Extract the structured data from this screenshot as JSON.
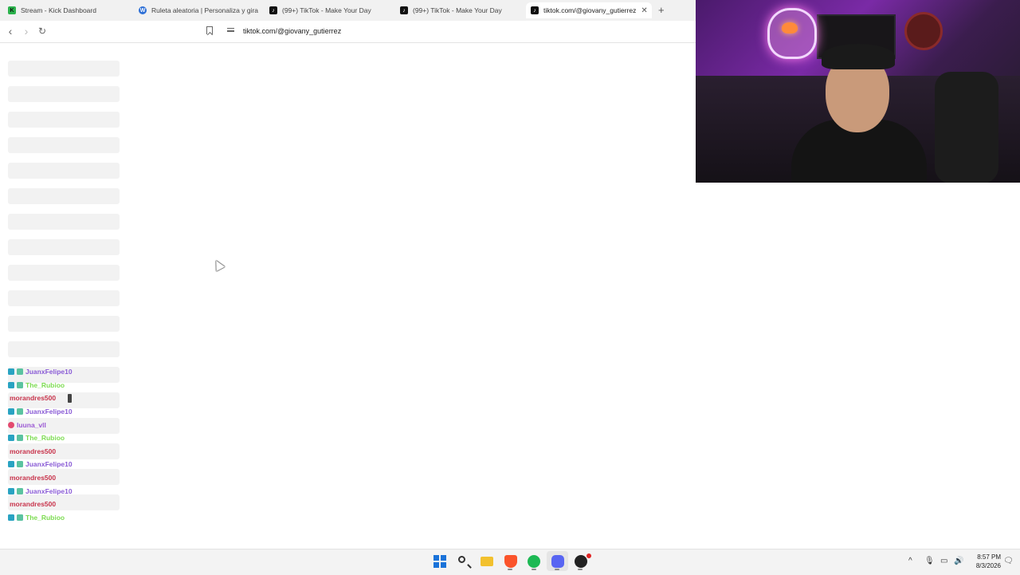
{
  "browser": {
    "tabs": [
      {
        "label": "Stream - Kick Dashboard",
        "favicon": "kick-icon"
      },
      {
        "label": "Ruleta aleatoria | Personaliza y gira t",
        "favicon": "wheel-icon"
      },
      {
        "label": "(99+) TikTok - Make Your Day",
        "favicon": "tiktok-icon"
      },
      {
        "label": "(99+) TikTok - Make Your Day",
        "favicon": "tiktok-icon"
      },
      {
        "label": "tiktok.com/@giovany_gutierrez",
        "favicon": "tiktok-icon",
        "active": true
      }
    ],
    "close_glyph": "✕",
    "new_tab_glyph": "+",
    "nav": {
      "back": "‹",
      "forward": "›",
      "reload": "↻"
    },
    "url": "tiktok.com/@giovany_gutierrez"
  },
  "chat": {
    "messages": [
      {
        "user": "JuanxFelipe10",
        "color": "#8a5cd6",
        "badges": [
          "sub",
          "gift"
        ]
      },
      {
        "user": "The_Rubioo",
        "color": "#7ddc52",
        "badges": [
          "sub",
          "gift"
        ]
      },
      {
        "user": "morandres500",
        "color": "#c8344c",
        "badges": [],
        "emote": true
      },
      {
        "user": "JuanxFelipe10",
        "color": "#8a5cd6",
        "badges": [
          "sub",
          "gift"
        ]
      },
      {
        "user": "luuna_vll",
        "color": "#9b5ad4",
        "badges": [
          "small"
        ]
      },
      {
        "user": "The_Rubioo",
        "color": "#7ddc52",
        "badges": [
          "sub",
          "gift"
        ]
      },
      {
        "user": "morandres500",
        "color": "#c8344c",
        "badges": []
      },
      {
        "user": "JuanxFelipe10",
        "color": "#8a5cd6",
        "badges": [
          "sub",
          "gift"
        ]
      },
      {
        "user": "morandres500",
        "color": "#c8344c",
        "badges": []
      },
      {
        "user": "JuanxFelipe10",
        "color": "#8a5cd6",
        "badges": [
          "sub",
          "gift"
        ]
      },
      {
        "user": "morandres500",
        "color": "#c8344c",
        "badges": []
      },
      {
        "user": "The_Rubioo",
        "color": "#7ddc52",
        "badges": [
          "sub",
          "gift"
        ]
      }
    ]
  },
  "taskbar": {
    "apps": [
      "windows-start-icon",
      "search-icon",
      "file-explorer-icon",
      "brave-browser-icon",
      "spotify-icon",
      "discord-icon",
      "obs-icon"
    ],
    "tray": {
      "chevron": "^"
    },
    "time": "8:57 PM",
    "date": "8/3/2026"
  }
}
